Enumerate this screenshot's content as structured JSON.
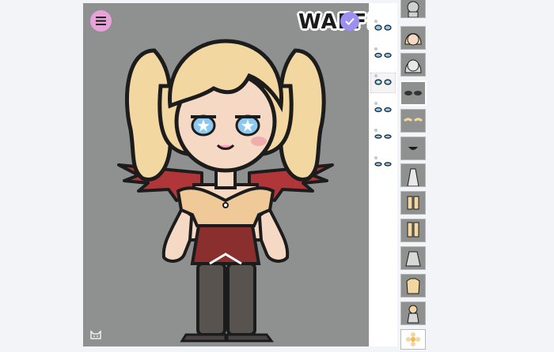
{
  "app": {
    "logo_text": "WAFFL",
    "menu_icon": "hamburger-menu-icon",
    "confirm_icon": "checkmark-icon",
    "corner_icon": "cat-icon"
  },
  "colors": {
    "stage_bg": "#8f9190",
    "menu_button": "#e7a3d9",
    "confirm_button": "#9d8ff0",
    "page_bg": "#f3f4f7"
  },
  "eye_options": {
    "selected_index": 2,
    "items": [
      "eyes-option-1",
      "eyes-option-2",
      "eyes-option-3",
      "eyes-option-4",
      "eyes-option-5",
      "eyes-option-6"
    ]
  },
  "categories": {
    "active_index": 3,
    "items": [
      {
        "name": "body-category",
        "icon": "body-icon"
      },
      {
        "name": "hair-category",
        "icon": "hair-front-icon"
      },
      {
        "name": "hair-back-category",
        "icon": "hair-back-icon"
      },
      {
        "name": "eyes-category",
        "icon": "eyes-icon"
      },
      {
        "name": "eyebrows-category",
        "icon": "eyebrows-icon"
      },
      {
        "name": "mouth-category",
        "icon": "mouth-icon"
      },
      {
        "name": "neck-category",
        "icon": "neck-icon"
      },
      {
        "name": "shoes-category",
        "icon": "shoes-icon"
      },
      {
        "name": "socks-category",
        "icon": "socks-icon"
      },
      {
        "name": "dress-category",
        "icon": "dress-icon"
      },
      {
        "name": "top-category",
        "icon": "top-icon"
      },
      {
        "name": "accessory-category",
        "icon": "accessory-icon"
      },
      {
        "name": "extras-category",
        "icon": "flower-icon"
      }
    ]
  }
}
